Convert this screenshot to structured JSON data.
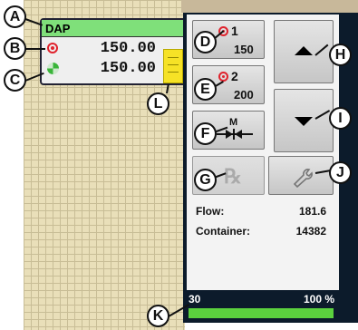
{
  "product": {
    "name": "DAP",
    "target_rate": "150.00",
    "actual_rate": "150.00"
  },
  "presets": [
    {
      "index": "1",
      "rate": "150"
    },
    {
      "index": "2",
      "rate": "200"
    }
  ],
  "stats": {
    "flow_label": "Flow:",
    "flow_value": "181.6",
    "container_label": "Container:",
    "container_value": "14382"
  },
  "bottom": {
    "left_value": "30",
    "right_value": "100 %",
    "fill_fraction": 1.0
  },
  "buttons": {
    "manual_label": "M"
  },
  "callouts": [
    "A",
    "B",
    "C",
    "D",
    "E",
    "F",
    "G",
    "H",
    "I",
    "J",
    "K",
    "L"
  ],
  "colors": {
    "title_bar": "#7fe07a",
    "target": "#e0232d",
    "actual": "#3ab53a",
    "panel_dark": "#0c1b2b",
    "progress": "#5bd23e",
    "level_bar": "#f6e226"
  },
  "icons": [
    "target-rate-icon",
    "actual-rate-icon",
    "up-arrow-icon",
    "down-arrow-icon",
    "manual-valve-icon",
    "prescription-icon",
    "wrench-icon"
  ]
}
